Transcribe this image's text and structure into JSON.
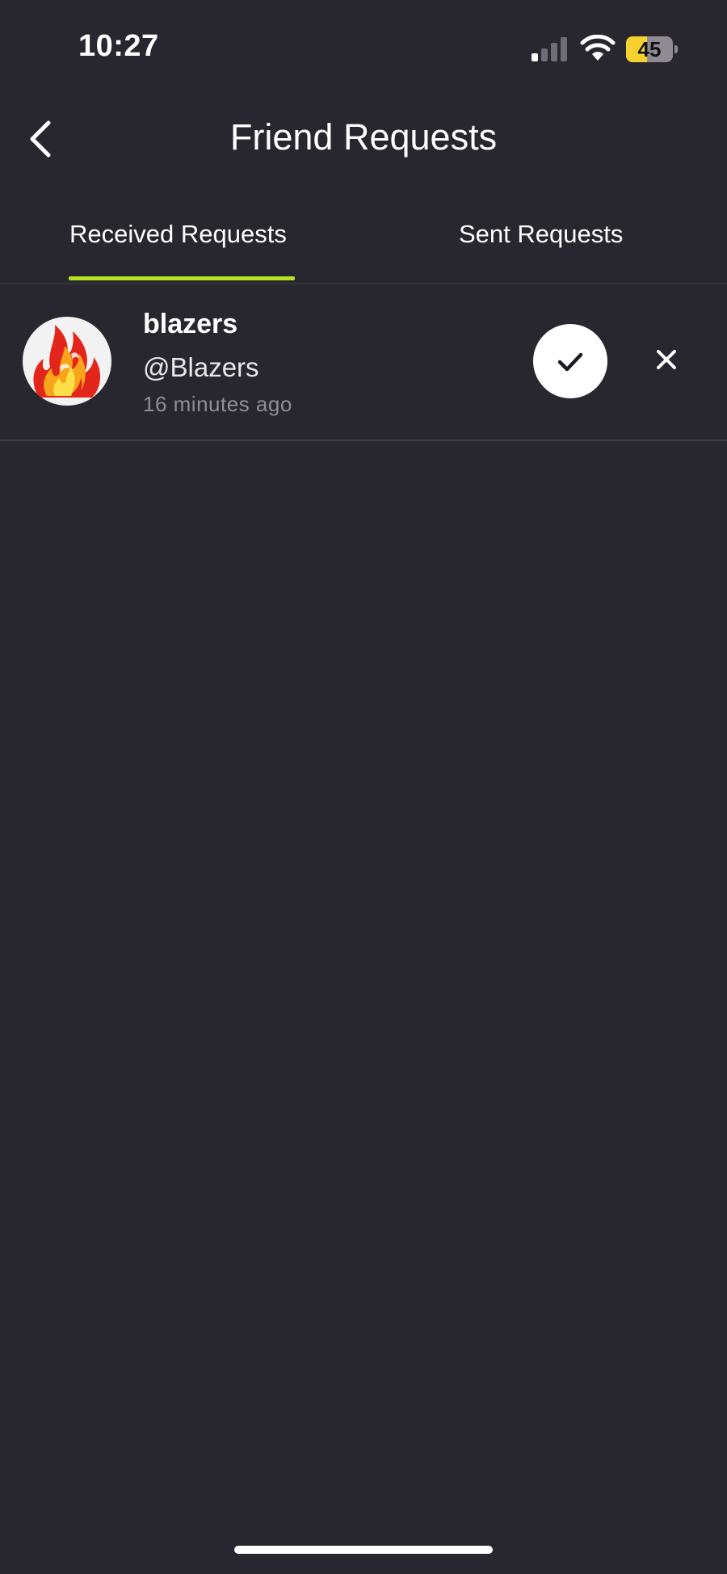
{
  "status_bar": {
    "time": "10:27",
    "battery_level": 45,
    "battery_text": "45",
    "signal_bars_active": 1,
    "signal_bars_total": 4
  },
  "header": {
    "title": "Friend Requests",
    "back_icon": "chevron-left-icon"
  },
  "tabs": [
    {
      "label": "Received Requests",
      "active": true
    },
    {
      "label": "Sent Requests",
      "active": false
    }
  ],
  "colors": {
    "background": "#28262f",
    "accent": "#b6e31e",
    "battery": "#f5d230",
    "secondary_text": "#8f8d95"
  },
  "requests": [
    {
      "name": "blazers",
      "handle": "@Blazers",
      "time": "16 minutes ago",
      "avatar_icon": "flame-icon",
      "accept_icon": "checkmark-icon",
      "decline_icon": "close-icon"
    }
  ]
}
